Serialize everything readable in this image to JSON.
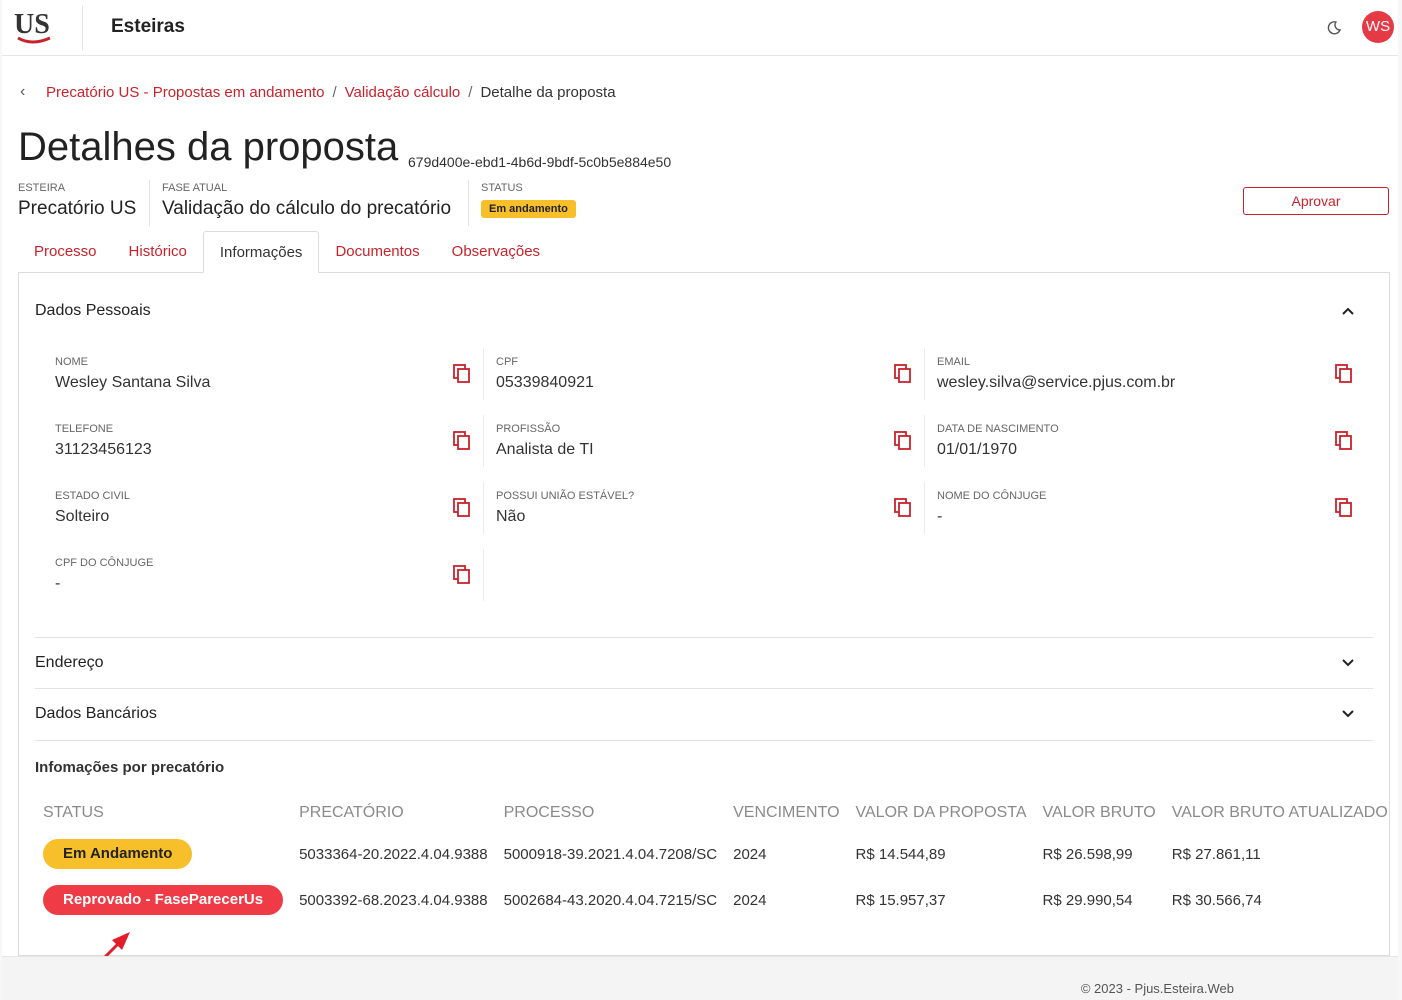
{
  "header": {
    "logo_text": "US",
    "app_title": "Esteiras",
    "avatar_initials": "WS"
  },
  "breadcrumb": {
    "items": [
      "Precatório US - Propostas em andamento",
      "Validação cálculo"
    ],
    "current": "Detalhe da proposta",
    "separator": "/"
  },
  "page": {
    "title": "Detalhes da proposta",
    "id": "679d400e-ebd1-4b6d-9bdf-5c0b5e884e50",
    "esteira_label": "ESTEIRA",
    "esteira_value": "Precatório US",
    "fase_label": "FASE ATUAL",
    "fase_value": "Validação do cálculo do precatório",
    "status_label": "STATUS",
    "status_value": "Em andamento",
    "approve_label": "Aprovar"
  },
  "tabs": [
    "Processo",
    "Histórico",
    "Informações",
    "Documentos",
    "Observações"
  ],
  "active_tab": "Informações",
  "dados_pessoais": {
    "title": "Dados Pessoais",
    "fields": [
      {
        "label": "NOME",
        "value": "Wesley Santana Silva"
      },
      {
        "label": "CPF",
        "value": "05339840921"
      },
      {
        "label": "EMAIL",
        "value": "wesley.silva@service.pjus.com.br"
      },
      {
        "label": "TELEFONE",
        "value": "31123456123"
      },
      {
        "label": "PROFISSÃO",
        "value": "Analista de TI"
      },
      {
        "label": "DATA DE NASCIMENTO",
        "value": "01/01/1970"
      },
      {
        "label": "ESTADO CIVIL",
        "value": "Solteiro"
      },
      {
        "label": "POSSUI UNIÃO ESTÁVEL?",
        "value": "Não"
      },
      {
        "label": "NOME DO CÔNJUGE",
        "value": "-"
      },
      {
        "label": "CPF DO CÔNJUGE",
        "value": "-"
      }
    ]
  },
  "sections": {
    "endereco": "Endereço",
    "dados_bancarios": "Dados Bancários"
  },
  "precatorios": {
    "title": "Infomações por precatório",
    "columns": [
      "STATUS",
      "PRECATÓRIO",
      "PROCESSO",
      "VENCIMENTO",
      "VALOR DA PROPOSTA",
      "VALOR BRUTO",
      "VALOR BRUTO ATUALIZADO"
    ],
    "rows": [
      {
        "status": "Em Andamento",
        "precatorio": "5033364-20.2022.4.04.9388",
        "processo": "5000918-39.2021.4.04.7208/SC",
        "vencimento": "2024",
        "valor_proposta": "R$ 14.544,89",
        "valor_bruto": "R$ 26.598,99",
        "valor_bruto_atualizado": "R$ 27.861,11"
      },
      {
        "status": "Reprovado - FaseParecerUs",
        "precatorio": "5003392-68.2023.4.04.9388",
        "processo": "5002684-43.2020.4.04.7215/SC",
        "vencimento": "2024",
        "valor_proposta": "R$ 15.957,37",
        "valor_bruto": "R$ 29.990,54",
        "valor_bruto_atualizado": "R$ 30.566,74"
      }
    ]
  },
  "colors": {
    "brand": "#c8232c",
    "warning": "#f7c02b",
    "danger": "#ee3b45"
  },
  "footer": {
    "text": "© 2023 - Pjus.Esteira.Web"
  }
}
